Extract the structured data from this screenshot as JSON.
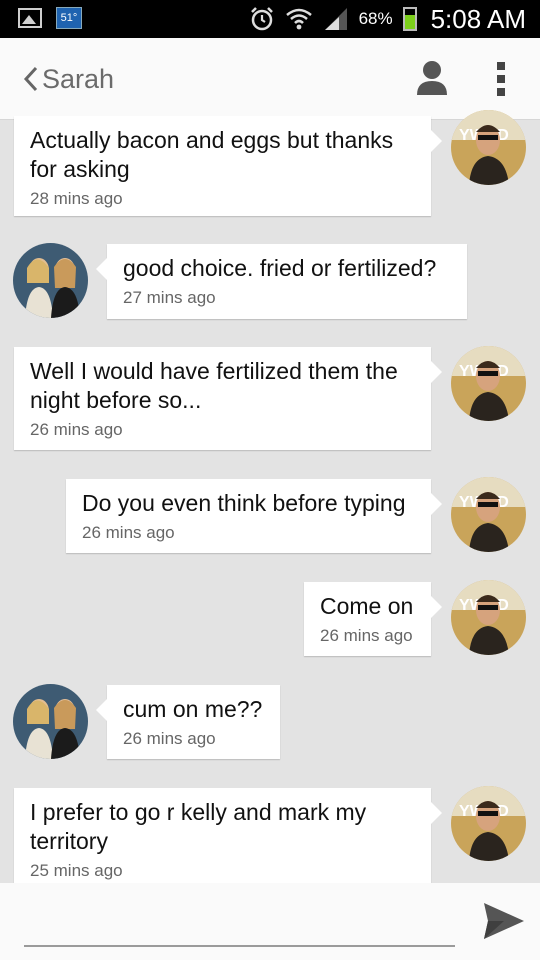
{
  "status_bar": {
    "weather_temp": "51°",
    "battery_percent": "68%",
    "battery_level": 0.68,
    "time": "5:08 AM",
    "icons": [
      "image-icon",
      "weather-icon",
      "alarm-icon",
      "wifi-icon",
      "signal-icon",
      "battery-icon"
    ]
  },
  "header": {
    "contact_name": "Sarah",
    "icons": [
      "back-chevron-icon",
      "contact-person-icon",
      "overflow-menu-icon"
    ]
  },
  "messages": [
    {
      "direction": "sent",
      "text": "Actually bacon and eggs but thanks for asking",
      "time": "28 mins ago"
    },
    {
      "direction": "received",
      "text": "good choice. fried or fertilized?",
      "time": "27 mins ago"
    },
    {
      "direction": "sent",
      "text": "Well I would have fertilized them the night before so...",
      "time": "26 mins ago"
    },
    {
      "direction": "sent",
      "text": "Do you even think before typing",
      "time": "26 mins ago"
    },
    {
      "direction": "sent",
      "text": "Come on",
      "time": "26 mins ago"
    },
    {
      "direction": "received",
      "text": "cum on me??",
      "time": "26 mins ago"
    },
    {
      "direction": "sent",
      "text": "I prefer to go r kelly and mark my territory",
      "time": "25 mins ago"
    }
  ],
  "compose": {
    "placeholder": "",
    "send_icon": "send-icon"
  },
  "colors": {
    "status_bar_bg": "#000000",
    "header_bg": "#fafafa",
    "chat_bg": "#e3e3e3",
    "bubble_bg": "#ffffff",
    "battery_green": "#7ccf1b"
  }
}
